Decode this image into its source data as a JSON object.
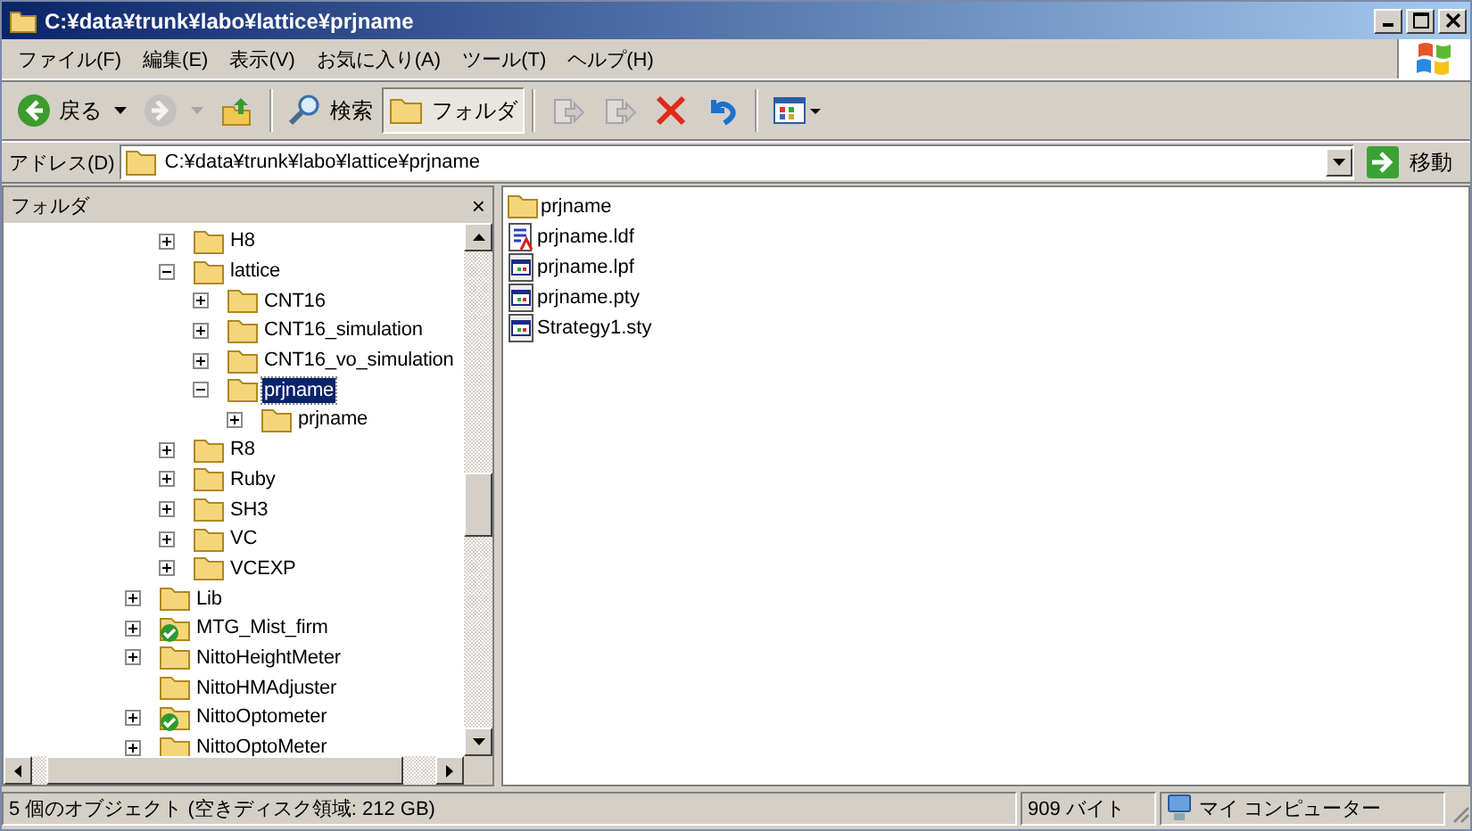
{
  "window": {
    "title": "C:¥data¥trunk¥labo¥lattice¥prjname"
  },
  "menu": [
    "ファイル(F)",
    "編集(E)",
    "表示(V)",
    "お気に入り(A)",
    "ツール(T)",
    "ヘルプ(H)"
  ],
  "toolbar": [
    {
      "kind": "back",
      "label": "戻る",
      "disabled": false,
      "selected": false
    },
    {
      "kind": "forward",
      "disabled": true,
      "selected": false
    },
    {
      "kind": "up",
      "disabled": false,
      "selected": false
    },
    {
      "kind": "search",
      "label": "検索",
      "disabled": false,
      "selected": false
    },
    {
      "kind": "folders",
      "label": "フォルダ",
      "disabled": false,
      "selected": true
    },
    {
      "kind": "moveto",
      "disabled": true,
      "selected": false
    },
    {
      "kind": "copyto",
      "disabled": true,
      "selected": false
    },
    {
      "kind": "delete",
      "disabled": false,
      "selected": false
    },
    {
      "kind": "undo",
      "disabled": false,
      "selected": false
    },
    {
      "kind": "views",
      "disabled": false,
      "selected": false
    }
  ],
  "address": {
    "label": "アドレス(D)",
    "value": "C:¥data¥trunk¥labo¥lattice¥prjname",
    "go": "移動"
  },
  "folder_pane": {
    "title": "フォルダ",
    "close": "×"
  },
  "tree": {
    "items": [
      {
        "children": [
          {
            "label": "H8",
            "kind": "folder",
            "has_children": true,
            "expanded": false,
            "selected": false
          },
          {
            "label": "lattice",
            "kind": "folder",
            "has_children": true,
            "expanded": true,
            "selected": false,
            "children": [
              {
                "label": "CNT16",
                "kind": "folder",
                "has_children": true,
                "expanded": false,
                "selected": false
              },
              {
                "label": "CNT16_simulation",
                "kind": "folder",
                "has_children": true,
                "expanded": false,
                "selected": false
              },
              {
                "label": "CNT16_vo_simulation",
                "kind": "folder",
                "has_children": true,
                "expanded": false,
                "selected": false
              },
              {
                "label": "prjname",
                "kind": "folder",
                "has_children": true,
                "expanded": true,
                "selected": true,
                "children": [
                  {
                    "label": "prjname",
                    "kind": "folder",
                    "has_children": true,
                    "expanded": false,
                    "selected": false
                  }
                ]
              }
            ]
          },
          {
            "label": "R8",
            "kind": "folder",
            "has_children": true,
            "expanded": false,
            "selected": false
          },
          {
            "label": "Ruby",
            "kind": "folder",
            "has_children": true,
            "expanded": false,
            "selected": false
          },
          {
            "label": "SH3",
            "kind": "folder",
            "has_children": true,
            "expanded": false,
            "selected": false
          },
          {
            "label": "VC",
            "kind": "folder",
            "has_children": true,
            "expanded": false,
            "selected": false
          },
          {
            "label": "VCEXP",
            "kind": "folder",
            "has_children": true,
            "expanded": false,
            "selected": false
          }
        ]
      },
      {
        "label": "Lib",
        "kind": "folder",
        "has_children": true,
        "expanded": false,
        "selected": false
      },
      {
        "label": "MTG_Mist_firm",
        "kind": "checked_folder",
        "has_children": true,
        "expanded": false,
        "selected": false
      },
      {
        "label": "NittoHeightMeter",
        "kind": "folder",
        "has_children": true,
        "expanded": false,
        "selected": false
      },
      {
        "label": "NittoHMAdjuster",
        "kind": "folder",
        "has_children": false,
        "selected": false
      },
      {
        "label": "NittoOptometer",
        "kind": "checked_folder",
        "has_children": true,
        "expanded": false,
        "selected": false
      },
      {
        "label": "NittoOptoMeter",
        "kind": "folder",
        "has_children": true,
        "expanded": false,
        "selected": false
      }
    ]
  },
  "files": [
    {
      "name": "prjname",
      "kind": "folder"
    },
    {
      "name": "prjname.ldf",
      "kind": "ldf"
    },
    {
      "name": "prjname.lpf",
      "kind": "app"
    },
    {
      "name": "prjname.pty",
      "kind": "app"
    },
    {
      "name": "Strategy1.sty",
      "kind": "app"
    }
  ],
  "status_bar": {
    "objects": "5 個のオブジェクト (空きディスク領域: 212 GB)",
    "size": "909 バイト",
    "location": "マイ コンピューター"
  }
}
